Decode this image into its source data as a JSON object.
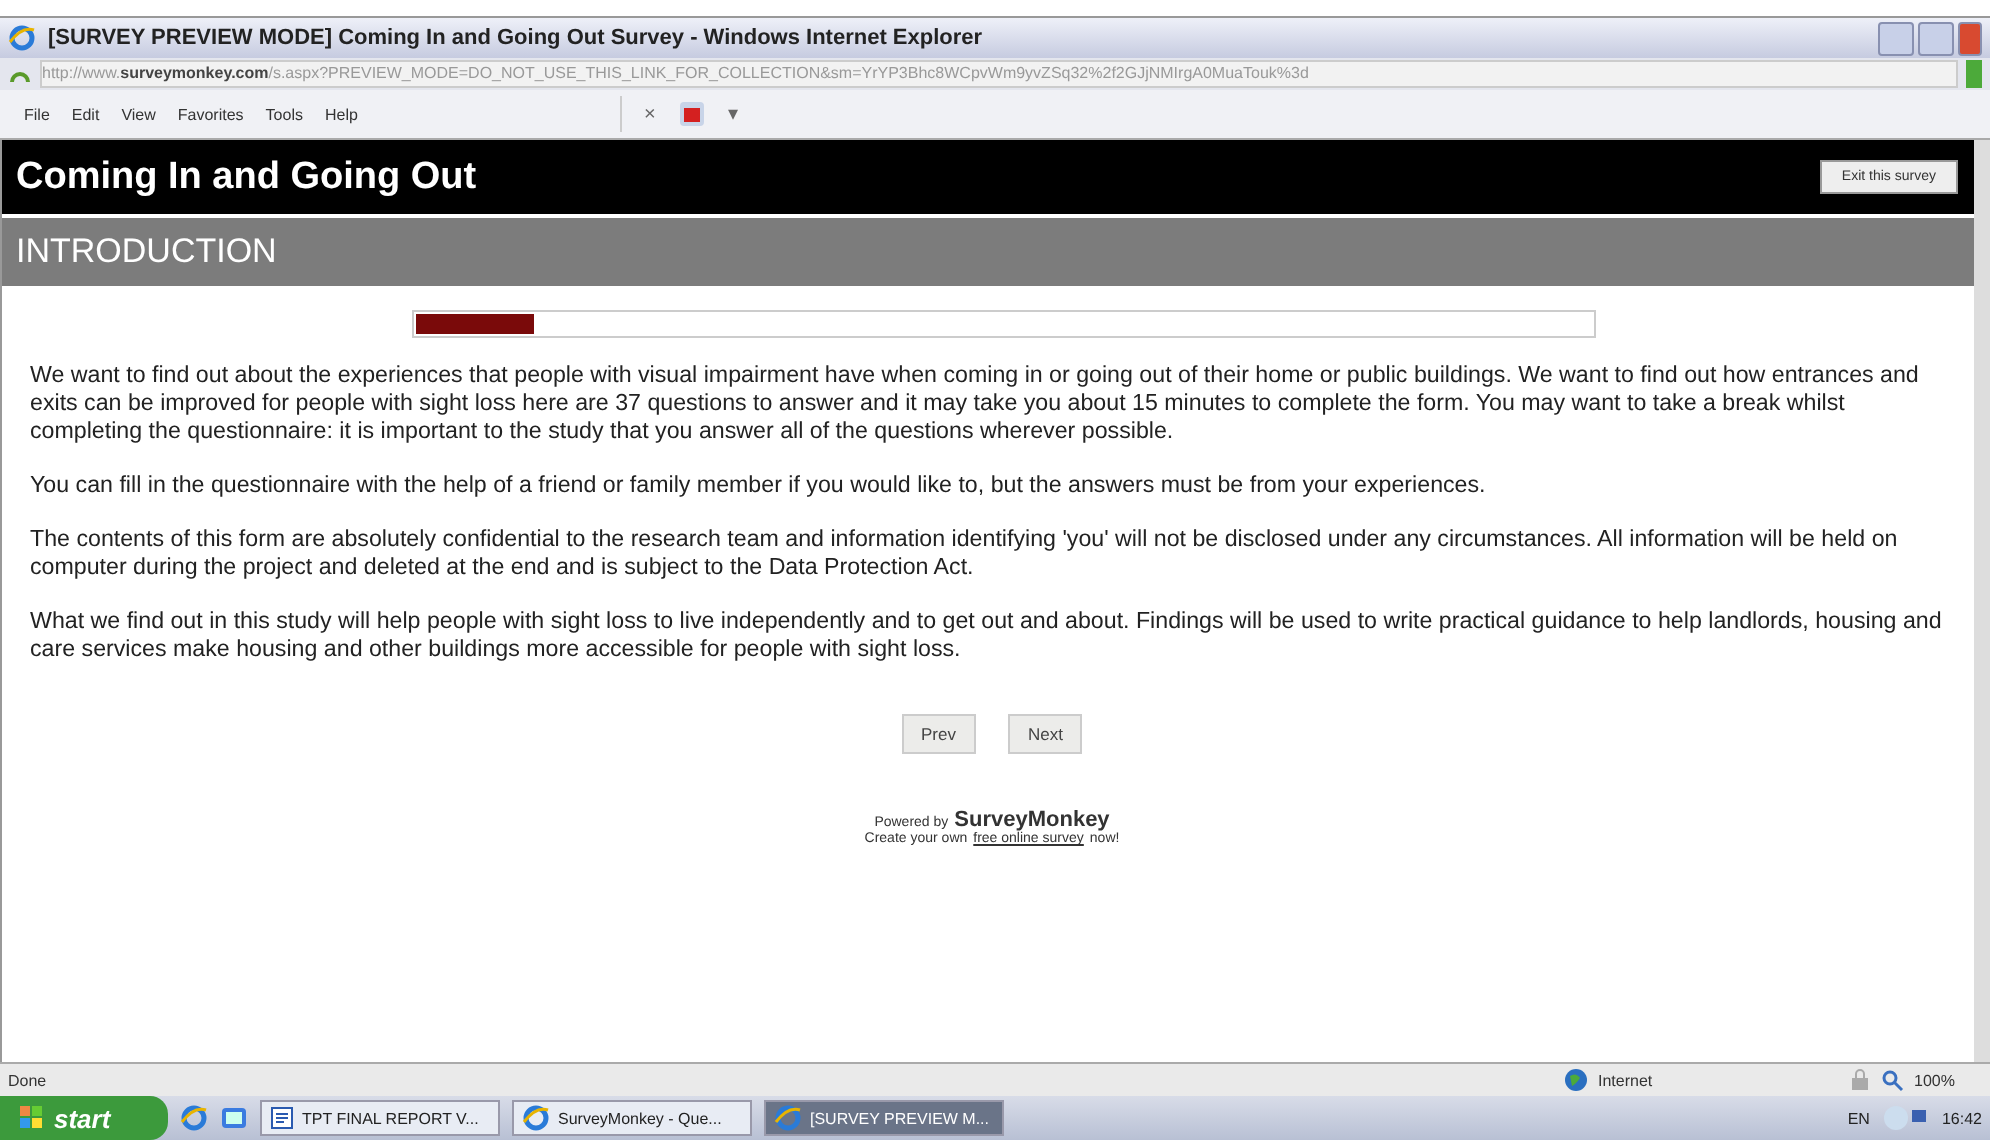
{
  "window": {
    "title": "[SURVEY PREVIEW MODE] Coming In and Going Out Survey - Windows Internet Explorer"
  },
  "address_bar": {
    "value": "http://www.**surveymonkey.com**/s.aspx?PREVIEW_MODE=DO_NOT_USE_THIS_LINK_FOR_COLLECTION&sm=YrYP3Bhc8WCpvWm9yvZSq32%2f2GJjNMIrgA0MuaTouk%3d"
  },
  "menu": [
    "File",
    "Edit",
    "View",
    "Favorites",
    "Tools",
    "Help"
  ],
  "toolbar": {
    "close_tab": "×",
    "dropdown": "▾"
  },
  "survey": {
    "title": "Coming In and Going Out",
    "exit_button": "Exit this survey",
    "section": "INTRODUCTION",
    "progress": {
      "level": 0.1
    },
    "paragraphs": [
      "We want to find out about the experiences that people with visual impairment have when coming in or going out of their home or public buildings. We want to find out how entrances and exits can be improved for people with sight loss here are 37 questions to answer and it may take you about 15 minutes to complete the form. You may want to take a break whilst completing the questionnaire: it is important to the study that you answer all of the questions wherever possible.",
      "You can fill in the questionnaire with the help of a friend or family member if you would like to, but the answers must be from your experiences.",
      "The contents of this form are absolutely confidential to the research team and information identifying 'you' will not be disclosed under any circumstances. All information will be held on computer during the project and deleted at the end and is subject to the Data Protection Act.",
      "What we find out in this study will help people with sight loss to live independently and to get out and about. Findings will be used to write practical guidance to help landlords, housing and care services make housing and other buildings more accessible for people with sight loss."
    ],
    "buttons": [
      "Prev",
      "Next"
    ],
    "powered_by": "Powered by",
    "brand": "SurveyMonkey",
    "create_prefix": "Create your own",
    "create_link": "free online survey",
    "create_suffix": "now!"
  },
  "status_bar": {
    "text": "Done",
    "zone": "Internet",
    "zoom": "100%"
  },
  "taskbar": {
    "start": "start",
    "tasks": [
      {
        "label": "TPT FINAL REPORT V...",
        "kind": "document",
        "selected": false
      },
      {
        "label": "SurveyMonkey - Que...",
        "kind": "browser",
        "selected": false
      },
      {
        "label": "[SURVEY PREVIEW M...",
        "kind": "browser",
        "selected": true
      }
    ],
    "language": "EN",
    "clock": "16:42"
  }
}
